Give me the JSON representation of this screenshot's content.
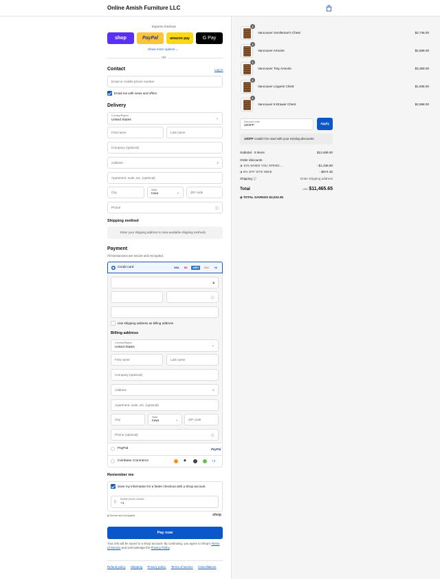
{
  "header": {
    "brand": "Online Amish Furniture LLC",
    "cart_icon": "shopping-bag-icon"
  },
  "express": {
    "label": "Express checkout",
    "buttons": [
      {
        "label": "shop",
        "color": "#5a31f4"
      },
      {
        "label": "PayPal",
        "color": "#ffc439"
      },
      {
        "label": "amazon pay",
        "color": "#ffd814"
      },
      {
        "label": "G Pay",
        "color": "#000000"
      }
    ],
    "more": "Show more options",
    "or": "OR"
  },
  "contact": {
    "title": "Contact",
    "login": "Log in",
    "email_placeholder": "Email or mobile phone number",
    "news_label": "Email me with news and offers"
  },
  "delivery": {
    "title": "Delivery",
    "country_label": "Country/Region",
    "country_value": "United States",
    "first_name": "First name",
    "last_name": "Last name",
    "company": "Company (optional)",
    "address": "Address",
    "apartment": "Apartment, suite, etc. (optional)",
    "city": "City",
    "state_label": "State",
    "state_value": "Iowa",
    "zip": "ZIP code",
    "phone": "Phone"
  },
  "shipping": {
    "title": "Shipping method",
    "message": "Enter your shipping address to view available shipping methods."
  },
  "payment": {
    "title": "Payment",
    "subtitle": "All transactions are secure and encrypted.",
    "credit_card": "Credit card",
    "card_brands": [
      "VISA",
      "MC",
      "AMEX",
      "DISC"
    ],
    "more_cards": "+4",
    "same_address": "Use shipping address as billing address",
    "paypal": "PayPal",
    "paypal_logo": "PayPal",
    "coinbase": "Coinbase Commerce",
    "coinbase_more": "+3"
  },
  "billing": {
    "title": "Billing address",
    "country_label": "Country/Region",
    "country_value": "United States",
    "first_name": "First name",
    "last_name": "Last name",
    "company": "Company (optional)",
    "address": "Address",
    "apartment": "Apartment, suite, etc. (optional)",
    "city": "City",
    "state_label": "State",
    "state_value": "Iowa",
    "zip": "ZIP code",
    "phone": "Phone (optional)"
  },
  "remember": {
    "title": "Remember me",
    "save_label": "Save my information for a faster checkout with a Shop account",
    "mobile_label": "Mobile phone number",
    "mobile_value": "+1",
    "secure": "Secure and encrypted",
    "shop_logo": "shop"
  },
  "pay": {
    "button": "Pay now",
    "note_1": "Your info will be saved to a Shop account. By continuing, you agree to Shop's",
    "terms": "Terms of Service",
    "note_2": "and acknowledge the",
    "privacy": "Privacy Policy",
    "note_end": "."
  },
  "footer": {
    "links": [
      "Refund policy",
      "Shipping",
      "Privacy policy",
      "Terms of service",
      "Cancellations"
    ]
  },
  "cart": {
    "items": [
      {
        "name": "Vancouver Gentleman's Chest",
        "price": "$2,748.00",
        "qty": "1"
      },
      {
        "name": "Vancouver Armoire",
        "price": "$2,658.00",
        "qty": "1"
      },
      {
        "name": "Vancouver Tray Armoire",
        "price": "$3,359.00",
        "qty": "1"
      },
      {
        "name": "Vancouver Lingerie Chest",
        "price": "$1,936.00",
        "qty": "1"
      },
      {
        "name": "Vancouver 6-Drawer Chest",
        "price": "$2,588.00",
        "qty": "1"
      }
    ],
    "discount_label": "Discount code",
    "discount_value": "10OFF",
    "apply": "Apply",
    "error_code": "10OFF",
    "error_text": "couldn't be used with your existing discounts.",
    "subtotal_label": "Subtotal · 5 items",
    "subtotal": "$13,489.00",
    "order_discounts": "Order discounts",
    "discounts": [
      {
        "name": "10% WHEN YOU SPEND ...",
        "amount": "- $1,348.90"
      },
      {
        "name": "5% OFF SITE WIDE",
        "amount": "- $674.45"
      }
    ],
    "shipping_label": "Shipping",
    "shipping_value": "Enter shipping address",
    "total_label": "Total",
    "currency": "USD",
    "total": "$11,465.65",
    "savings_label": "TOTAL SAVINGS",
    "savings": "$2,023.35"
  },
  "colors": {
    "accent": "#1a5bb8",
    "pay_button": "#0b57c9",
    "sidebar_bg": "#f5f5f5"
  }
}
